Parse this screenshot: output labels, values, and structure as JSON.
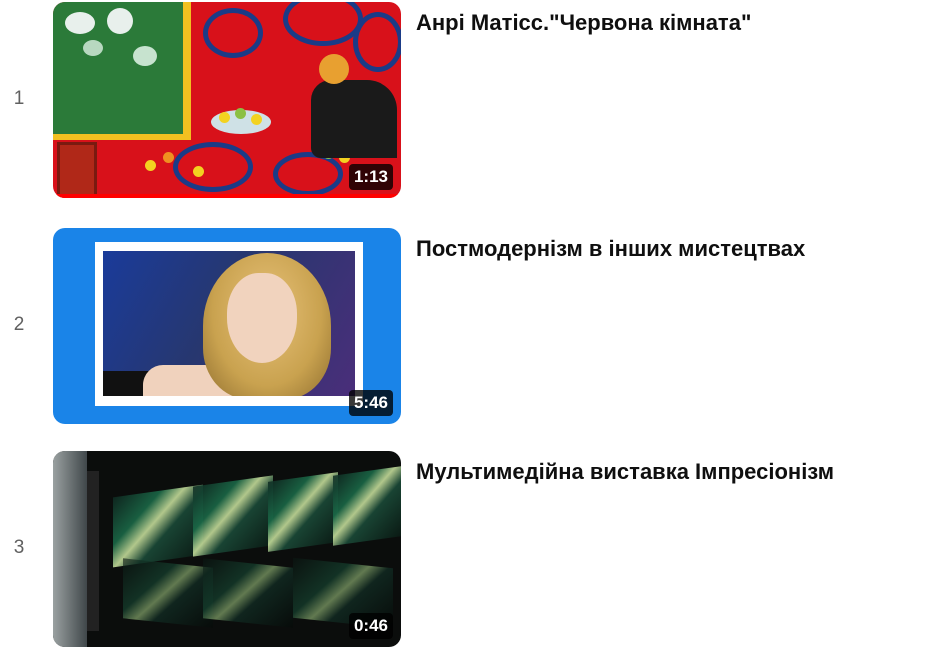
{
  "playlist": {
    "items": [
      {
        "index": "1",
        "title": "Анрі Матісс.\"Червона кімната\"",
        "duration": "1:13"
      },
      {
        "index": "2",
        "title": "Постмодернізм в інших мистецтвах",
        "duration": "5:46"
      },
      {
        "index": "3",
        "title": "Мультимедійна виставка Імпресіонізм",
        "duration": "0:46"
      }
    ]
  },
  "colors": {
    "progress_bar": "#ff0000",
    "thumb2_background": "#1a84e8"
  }
}
